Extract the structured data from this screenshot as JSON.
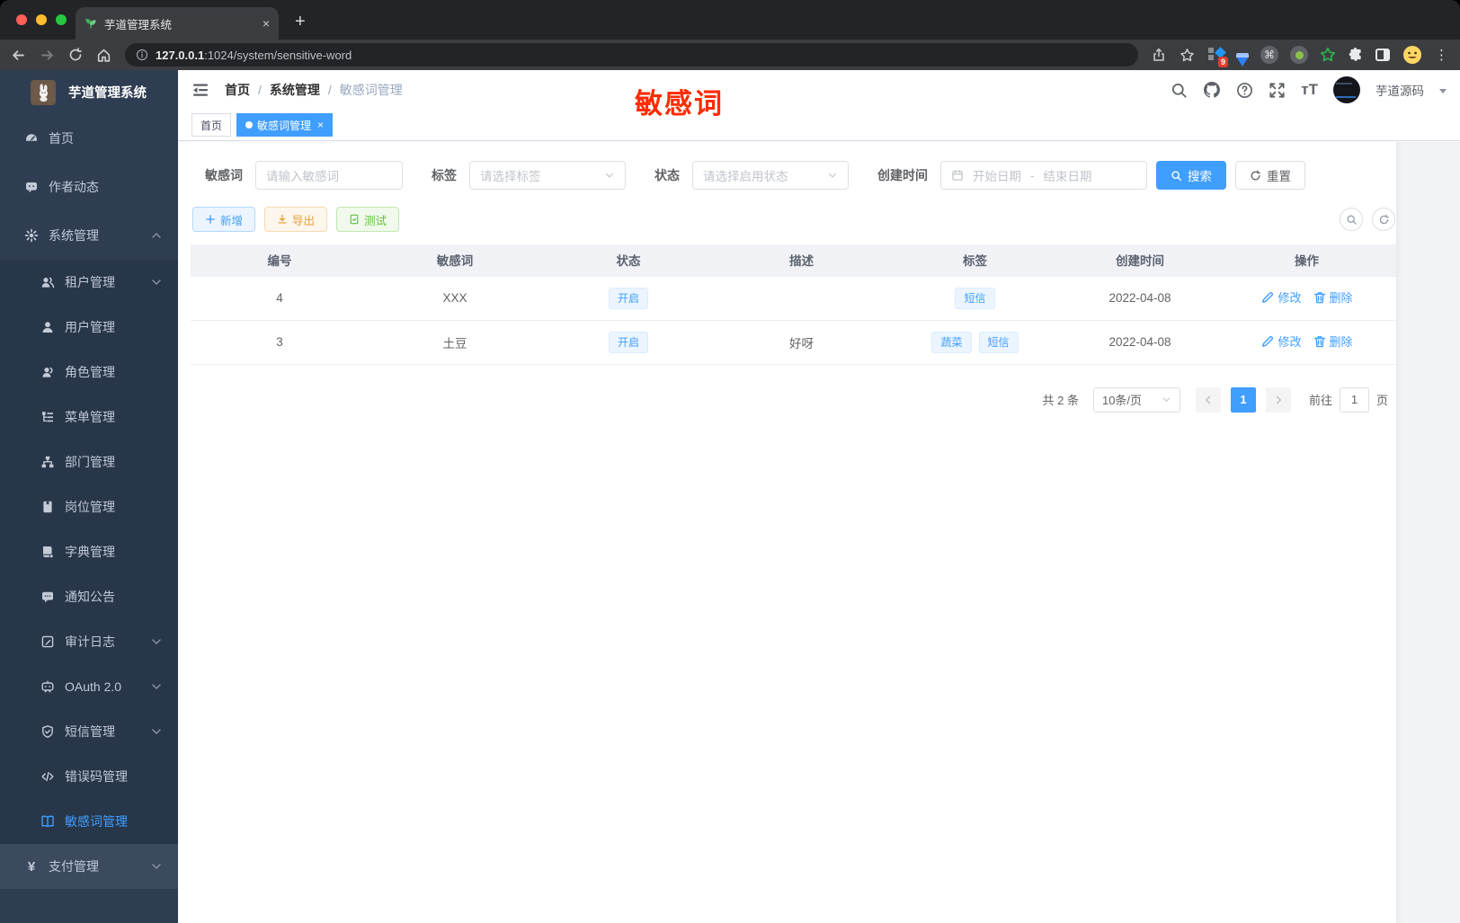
{
  "browser": {
    "tab_title": "芋道管理系统",
    "close_tab": "×",
    "new_tab": "+",
    "url_host": "127.0.0.1",
    "url_path": ":1024/system/sensitive-word",
    "ext_badge": "9",
    "menu_dots": "⋮"
  },
  "sidebar": {
    "logo_title": "芋道管理系统",
    "items": [
      {
        "key": "home",
        "label": "首页",
        "icon": "gauge-icon",
        "level": 1
      },
      {
        "key": "author-trends",
        "label": "作者动态",
        "icon": "chat-icon",
        "level": 1
      },
      {
        "key": "system",
        "label": "系统管理",
        "icon": "gear-icon",
        "level": 1,
        "chevron": "up"
      },
      {
        "key": "tenant",
        "label": "租户管理",
        "icon": "users-icon",
        "level": 2,
        "chevron": "down"
      },
      {
        "key": "user",
        "label": "用户管理",
        "icon": "user-icon",
        "level": 2
      },
      {
        "key": "role",
        "label": "角色管理",
        "icon": "role-icon",
        "level": 2
      },
      {
        "key": "menu",
        "label": "菜单管理",
        "icon": "menu-tree-icon",
        "level": 2
      },
      {
        "key": "dept",
        "label": "部门管理",
        "icon": "org-icon",
        "level": 2
      },
      {
        "key": "post",
        "label": "岗位管理",
        "icon": "badge-icon",
        "level": 2
      },
      {
        "key": "dict",
        "label": "字典管理",
        "icon": "dictionary-icon",
        "level": 2
      },
      {
        "key": "notice",
        "label": "通知公告",
        "icon": "announcement-icon",
        "level": 2
      },
      {
        "key": "audit-log",
        "label": "审计日志",
        "icon": "log-icon",
        "level": 2,
        "chevron": "down"
      },
      {
        "key": "oauth2",
        "label": "OAuth 2.0",
        "icon": "robot-icon",
        "level": 2,
        "chevron": "down"
      },
      {
        "key": "sms",
        "label": "短信管理",
        "icon": "shield-icon",
        "level": 2,
        "chevron": "down"
      },
      {
        "key": "error-code",
        "label": "错误码管理",
        "icon": "code-icon",
        "level": 2
      },
      {
        "key": "sensitive-word",
        "label": "敏感词管理",
        "icon": "open-book-icon",
        "level": 2,
        "active": true
      },
      {
        "key": "pay",
        "label": "支付管理",
        "icon": "yen-icon",
        "level": 1,
        "chevron": "down",
        "highlight": true
      }
    ]
  },
  "header": {
    "breadcrumb": [
      "首页",
      "系统管理",
      "敏感词管理"
    ],
    "user_name": "芋道源码"
  },
  "tags_view": [
    {
      "label": "首页"
    },
    {
      "label": "敏感词管理",
      "active": true,
      "closable": true
    }
  ],
  "annotation": {
    "text": "敏感词",
    "color": "#fe2c00"
  },
  "filters": {
    "word_label": "敏感词",
    "word_placeholder": "请输入敏感词",
    "tag_label": "标签",
    "tag_placeholder": "请选择标签",
    "status_label": "状态",
    "status_placeholder": "请选择启用状态",
    "date_label": "创建时间",
    "date_start": "开始日期",
    "date_sep": "-",
    "date_end": "结束日期",
    "search": "搜索",
    "reset": "重置"
  },
  "toolbar": {
    "add": "新增",
    "export": "导出",
    "test": "测试"
  },
  "table": {
    "headers": [
      "编号",
      "敏感词",
      "状态",
      "描述",
      "标签",
      "创建时间",
      "操作"
    ],
    "rows": [
      {
        "id": "4",
        "word": "XXX",
        "status": "开启",
        "desc": "",
        "tags": [
          "短信"
        ],
        "created": "2022-04-08"
      },
      {
        "id": "3",
        "word": "土豆",
        "status": "开启",
        "desc": "好呀",
        "tags": [
          "蔬菜",
          "短信"
        ],
        "created": "2022-04-08"
      }
    ],
    "edit": "修改",
    "delete": "删除"
  },
  "pagination": {
    "total": "共 2 条",
    "page_size": "10条/页",
    "page": "1",
    "goto": "前往",
    "goto_value": "1",
    "unit": "页"
  },
  "colors": {
    "accent": "#409eff",
    "sidebar_bg": "#2f3d52",
    "submenu_bg": "#283649"
  }
}
